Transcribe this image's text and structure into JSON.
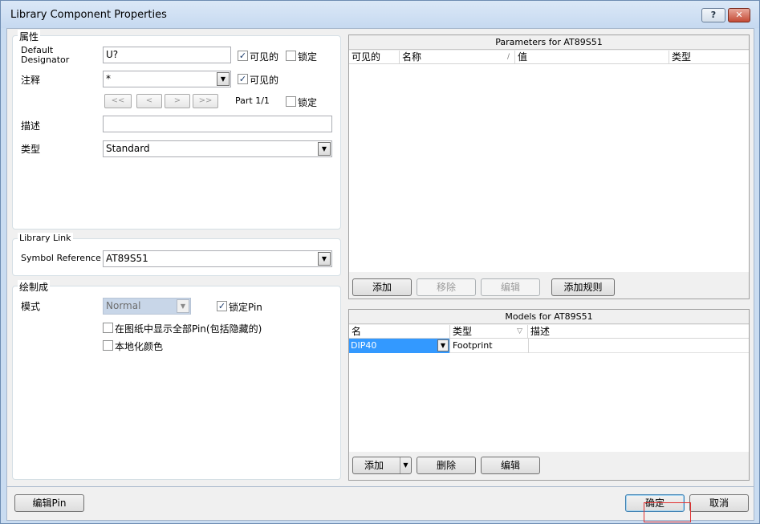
{
  "window": {
    "title": "Library Component Properties",
    "help_label": "?",
    "close_label": "✕"
  },
  "properties": {
    "group_title": "属性",
    "designator_label": "Default Designator",
    "designator_value": "U?",
    "designator_visible_checked": true,
    "visible_label": "可见的",
    "lock_label": "锁定",
    "designator_lock_checked": false,
    "comment_label": "注释",
    "comment_value": "*",
    "comment_visible_checked": true,
    "nav_first": "<<",
    "nav_prev": "<",
    "nav_next": ">",
    "nav_last": ">>",
    "part_label": "Part 1/1",
    "part_lock_checked": false,
    "description_label": "描述",
    "description_value": "",
    "type_label": "类型",
    "type_value": "Standard"
  },
  "library_link": {
    "group_title": "Library Link",
    "symbol_ref_label": "Symbol Reference",
    "symbol_ref_value": "AT89S51"
  },
  "graphical": {
    "group_title": "绘制成",
    "mode_label": "模式",
    "mode_value": "Normal",
    "lock_pins_label": "锁定Pin",
    "lock_pins_checked": true,
    "show_all_pins_label": "在图纸中显示全部Pin(包括隐藏的)",
    "show_all_pins_checked": false,
    "local_colors_label": "本地化颜色",
    "local_colors_checked": false
  },
  "parameters": {
    "title": "Parameters for AT89S51",
    "columns": [
      "可见的",
      "名称",
      "值",
      "类型"
    ],
    "sort_glyph": "/",
    "rows": [],
    "add_label": "添加",
    "remove_label": "移除",
    "edit_label": "编辑",
    "add_rule_label": "添加规则"
  },
  "models": {
    "title": "Models for AT89S51",
    "columns": [
      "名",
      "类型",
      "描述"
    ],
    "sort_glyph": "▽",
    "rows": [
      {
        "name": "DIP40",
        "type": "Footprint",
        "description": ""
      }
    ],
    "add_label": "添加",
    "delete_label": "删除",
    "edit_label": "编辑"
  },
  "footer": {
    "edit_pins_label": "编辑Pin",
    "ok_label": "确定",
    "cancel_label": "取消"
  },
  "colors": {
    "title_bar": "#c6d9f0",
    "selection": "#3399ff",
    "dialog_bg": "#f0f0f0"
  }
}
